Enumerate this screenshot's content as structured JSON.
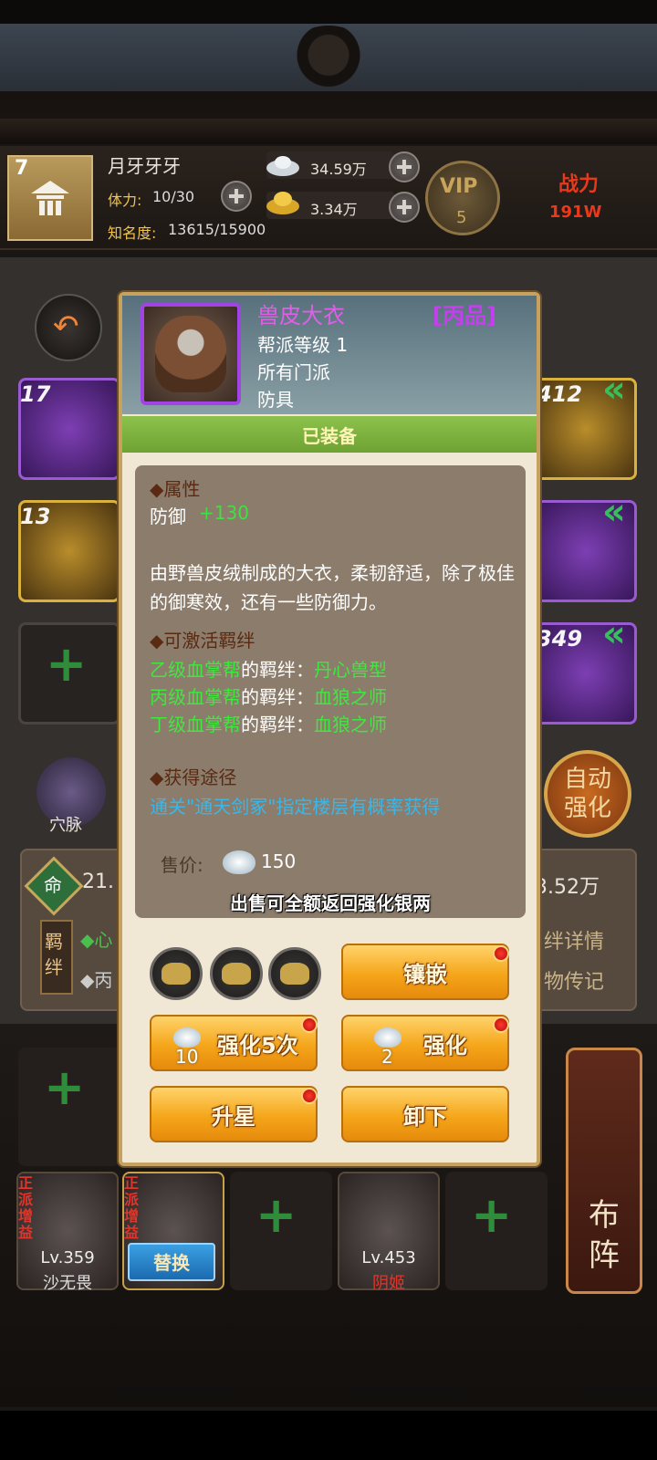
{
  "player": {
    "level": "7",
    "name": "月牙牙牙",
    "stamina_label": "体力:",
    "stamina_value": "10/30",
    "fame_label": "知名度:",
    "fame_value": "13615/15900"
  },
  "currency": {
    "silver": "34.59万",
    "gold": "3.34万"
  },
  "vip": {
    "label": "VIP",
    "level": "5"
  },
  "power": {
    "label": "战力",
    "value": "191W"
  },
  "background": {
    "slot_levels": [
      "17",
      "13",
      "412",
      "349"
    ],
    "xuemai_label": "穴脉",
    "auto_label": "自动强化",
    "ming_char": "命",
    "ming_value": "21.",
    "right_value": "3.52万",
    "jiban_char": "羁绊",
    "line1": "◆心",
    "line2": "◆丙",
    "right1": "绊详情",
    "right2": "物传记"
  },
  "team": {
    "hero1": {
      "tag": "正派增益",
      "level": "Lv.359",
      "name": "沙无畏"
    },
    "hero2": {
      "tag": "正派增益",
      "replace_label": "替换"
    },
    "hero3": {
      "level": "Lv.453",
      "name": "阴姬"
    },
    "buzhen_label": "布阵"
  },
  "colors": {
    "quality_purple": "#c63ef0",
    "equipped_green": "#8cc24c",
    "stat_green": "#3fe03f",
    "source_blue": "#3ab7e8",
    "button_orange": "#f5a61a"
  },
  "item": {
    "name": "兽皮大衣",
    "quality": "[丙品]",
    "guild_level": "帮派等级 1",
    "faction": "所有门派",
    "category": "防具",
    "equipped_label": "已装备",
    "attr_title": "◆属性",
    "stat_name": "防御",
    "stat_value": "+130",
    "description": "由野兽皮绒制成的大衣，柔韧舒适，除了极佳的御寒效，还有一些防御力。",
    "bond_title": "◆可激活羁绊",
    "bonds": [
      {
        "guild": "乙级血掌帮",
        "sep": "的羁绊：",
        "name": "丹心兽型"
      },
      {
        "guild": "丙级血掌帮",
        "sep": "的羁绊：",
        "name": "血狼之师"
      },
      {
        "guild": "丁级血掌帮",
        "sep": "的羁绊：",
        "name": "血狼之师"
      }
    ],
    "source_title": "◆获得途径",
    "source_text": "通关\"通天剑冢\"指定楼层有概率获得",
    "price_label": "售价:",
    "price_value": "150",
    "sell_note": "出售可全额返回强化银两"
  },
  "actions": {
    "inlay": "镶嵌",
    "enhance5": "强化5次",
    "enhance5_cost": "10",
    "enhance": "强化",
    "enhance_cost": "2",
    "star_up": "升星",
    "unequip": "卸下"
  }
}
